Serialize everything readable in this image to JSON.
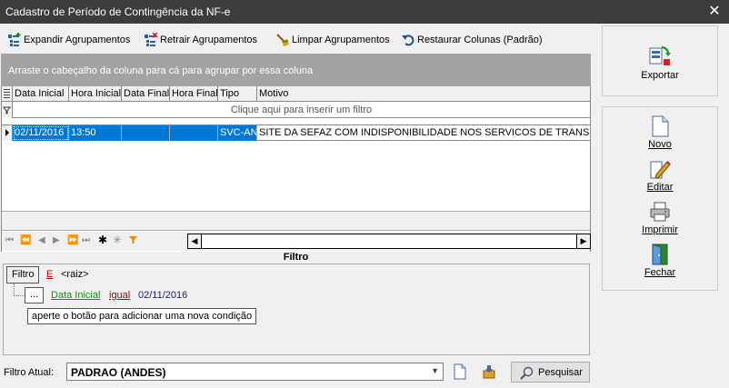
{
  "window": {
    "title": "Cadastro de Período de Contingência da NF-e",
    "close": "✕"
  },
  "toolbar": {
    "expand": "Expandir Agrupamentos",
    "collapse": "Retrair Agrupamentos",
    "clear": "Limpar Agrupamentos",
    "restore": "Restaurar Colunas (Padrão)"
  },
  "group_hint": "Arraste o cabeçalho da coluna para cá para agrupar por essa coluna",
  "grid": {
    "columns": [
      "Data Inicial",
      "Hora Inicial",
      "Data Final",
      "Hora Final",
      "Tipo",
      "Motivo"
    ],
    "filter_hint": "Clique aqui para inserir um filtro",
    "rows": [
      {
        "data_inicial": "02/11/2016",
        "hora_inicial": "13:50",
        "data_final": "",
        "hora_final": "",
        "tipo": "SVC-AN",
        "motivo": "SITE DA SEFAZ COM INDISPONIBILIDADE NOS SERVICOS DE TRANSMISSAO"
      }
    ]
  },
  "filter_panel": {
    "caption": "Filtro",
    "root_button": "Filtro",
    "operator": "E",
    "root": "<raiz>",
    "condition": {
      "ellipsis": "...",
      "field": "Data Inicial",
      "op": "igual",
      "value": "02/11/2016"
    },
    "hint": "aperte o botão para adicionar uma nova condição"
  },
  "bottom": {
    "label": "Filtro Atual:",
    "value": "PADRAO (ANDES)",
    "search": "Pesquisar"
  },
  "right": {
    "exportar": "Exportar",
    "novo": "Novo",
    "editar": "Editar",
    "imprimir": "Imprimir",
    "fechar": "Fechar"
  }
}
